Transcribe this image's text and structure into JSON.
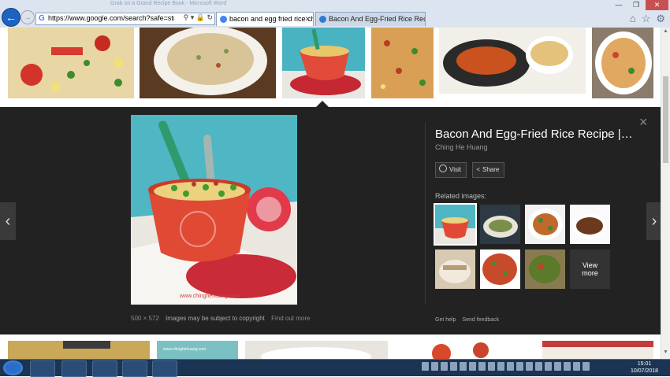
{
  "browser": {
    "ghost_title": "Grab on a Grand Recipe Book  -  Microsoft Word",
    "address_url": "https://www.google.com/search?safe=strict&tbs=s...",
    "address_tools": "⚲ ▾ 🔒 ↻",
    "tabs": [
      {
        "label": "bacon and egg fried rice chi...",
        "active": true
      },
      {
        "label": "Bacon And Egg-Fried Rice Reci..."
      }
    ],
    "window_controls": {
      "min": "—",
      "max": "❐",
      "close": "✕"
    },
    "toolbar_icons": [
      "home-icon",
      "star-icon",
      "gear-icon"
    ]
  },
  "preview": {
    "title": "Bacon And Egg-Fried Rice Recipe |…",
    "site": "Ching He Huang",
    "visit_label": "Visit",
    "share_label": "Share",
    "related_label": "Related images:",
    "view_more": [
      "View",
      "more"
    ],
    "image_dims": "500 × 572",
    "copyright_text": "Images may be subject to copyright",
    "find_out_more": "Find out more",
    "image_watermark": "www.chinghehuang.com",
    "get_help": "Get help",
    "send_feedback": "Send feedback",
    "prev_glyph": "‹",
    "next_glyph": "›",
    "close_glyph": "×"
  },
  "bottom_strip": {
    "watermark": "www.chinghehuang.com"
  },
  "taskbar": {
    "time": "15:01",
    "date": "10/07/2018",
    "apps": [
      "internet-explorer",
      "file-explorer",
      "media-player",
      "outlook",
      "word"
    ]
  },
  "colors": {
    "panel_bg": "#222222",
    "title_white": "#ffffff",
    "taskbar_bg": "#1b3453",
    "back_button_blue": "#1f63c0"
  }
}
